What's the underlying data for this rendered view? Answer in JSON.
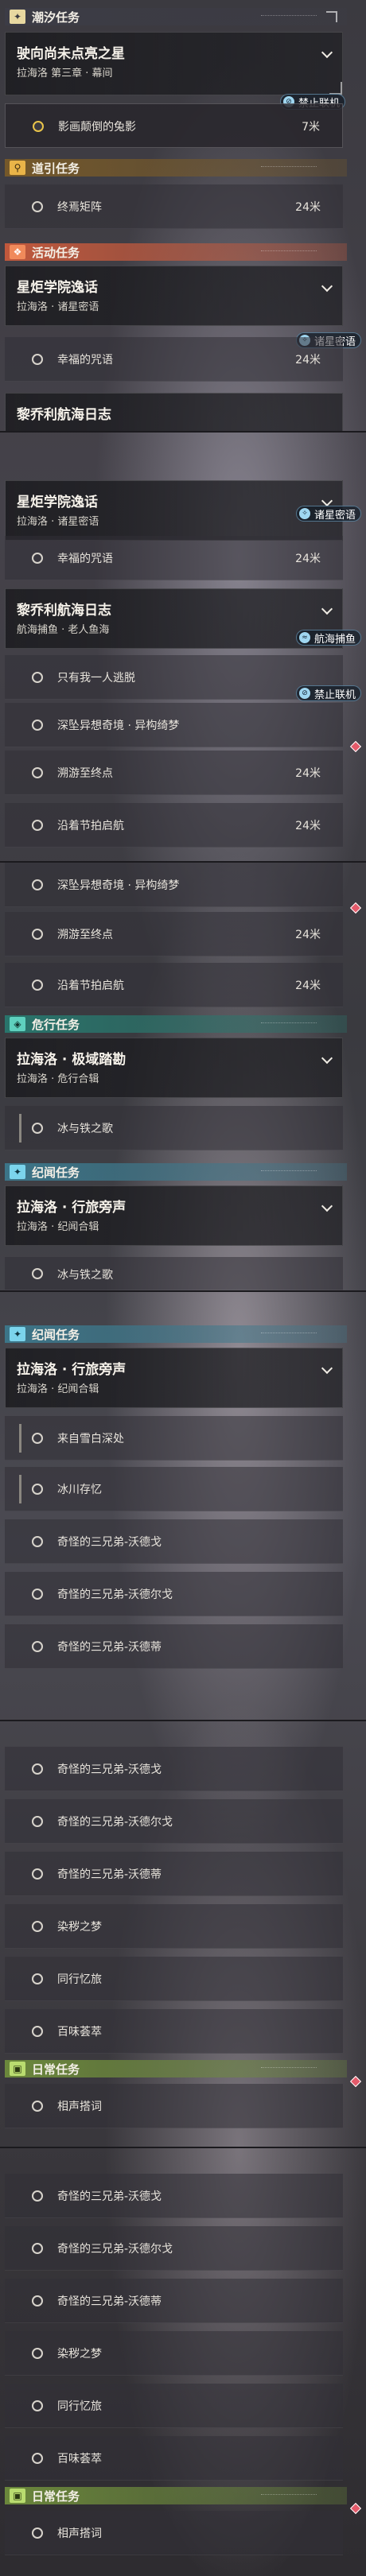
{
  "seg1": {
    "cat_chao": "潮汐任务",
    "q1_title": "驶向尚未点亮之星",
    "q1_sub": "拉海洛 第三章 · 幕间",
    "q1_step": "影画颠倒的兔影",
    "q1_dist": "7米",
    "ban": "禁止联机",
    "cat_dao": "道引任务",
    "dao_step": "终焉矩阵",
    "dao_dist": "24米",
    "cat_huo": "活动任务",
    "q2_title": "星炬学院逸话",
    "q2_sub": "拉海洛 · 诸星密语",
    "q2_tag": "诸星密语",
    "q2_step": "幸福的咒语",
    "q2_dist": "24米",
    "q3_peek": "黎乔利航海日志"
  },
  "seg2": {
    "q2_title": "星炬学院逸话",
    "q2_sub": "拉海洛 · 诸星密语",
    "q2_tag": "诸星密语",
    "q2_step": "幸福的咒语",
    "q2_dist": "24米",
    "q3_title": "黎乔利航海日志",
    "q3_sub": "航海捕鱼 · 老人鱼海",
    "q3_tag": "航海捕鱼",
    "q3_step": "只有我一人逃脱",
    "ban": "禁止联机",
    "r1": "深坠异想奇境 · 异构绮梦",
    "r2": "溯游至终点",
    "r2_dist": "24米",
    "r3": "沿着节拍启航",
    "r3_dist": "24米"
  },
  "seg3": {
    "r1": "深坠异想奇境 · 异构绮梦",
    "r2": "溯游至终点",
    "r2_dist": "24米",
    "r3": "沿着节拍启航",
    "r3_dist": "24米",
    "cat_wei": "危行任务",
    "q4_title": "拉海洛 · 极域踏勘",
    "q4_sub": "拉海洛 · 危行合辑",
    "q4_step": "冰与铁之歌",
    "cat_ji": "纪闻任务",
    "q5_title": "拉海洛 · 行旅旁声",
    "q5_sub": "拉海洛 · 纪闻合辑",
    "q5_peek": "冰与铁之歌"
  },
  "seg4": {
    "cat_ji": "纪闻任务",
    "q5_title": "拉海洛 · 行旅旁声",
    "q5_sub": "拉海洛 · 纪闻合辑",
    "s1": "来自雪白深处",
    "s2": "冰川存忆",
    "r1": "奇怪的三兄弟-沃德戈",
    "r2": "奇怪的三兄弟-沃德尔戈",
    "r3": "奇怪的三兄弟-沃德蒂"
  },
  "seg5": {
    "r1": "奇怪的三兄弟-沃德戈",
    "r2": "奇怪的三兄弟-沃德尔戈",
    "r3": "奇怪的三兄弟-沃德蒂",
    "r4": "染秽之梦",
    "r5": "同行忆旅",
    "r6": "百味荟萃",
    "cat_ri": "日常任务",
    "ri1": "相声搭词"
  },
  "seg6": {
    "r1": "奇怪的三兄弟-沃德戈",
    "r2": "奇怪的三兄弟-沃德尔戈",
    "r3": "奇怪的三兄弟-沃德蒂",
    "r4": "染秽之梦",
    "r5": "同行忆旅",
    "r6": "百味荟萃",
    "cat_ri": "日常任务",
    "ri1": "相声搭词"
  }
}
